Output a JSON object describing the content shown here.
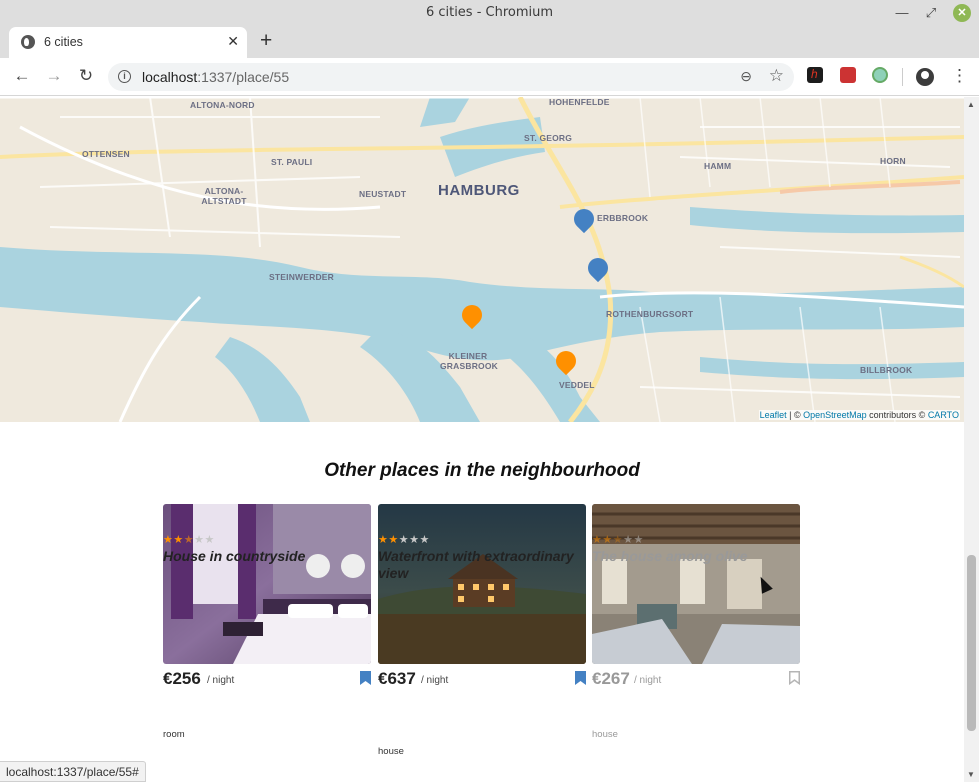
{
  "window": {
    "title": "6 cities - Chromium"
  },
  "tab": {
    "title": "6 cities"
  },
  "address_bar": {
    "host": "localhost",
    "path": ":1337/place/55"
  },
  "map": {
    "city_label": "HAMBURG",
    "districts": [
      "ALTONA-NORD",
      "HOHENFELDE",
      "OTTENSEN",
      "ST. PAULI",
      "ST. GEORG",
      "HAMM",
      "HORN",
      "ALTONA-ALTSTADT",
      "NEUSTADT",
      "ERBBROOK",
      "STEINWERDER",
      "ROTHENBURGSORT",
      "KLEINER GRASBROOK",
      "VEDDEL",
      "BILLBROOK"
    ],
    "attribution": {
      "leaflet": "Leaflet",
      "sep": " | © ",
      "osm": "OpenStreetMap",
      "mid": " contributors © ",
      "carto": "CARTO"
    }
  },
  "neighbourhood": {
    "title": "Other places in the neighbourhood",
    "per_night": "/ night",
    "cards": [
      {
        "price": "€256",
        "rating": 2.5,
        "name": "House in countryside",
        "type": "room",
        "bookmarked": true
      },
      {
        "price": "€637",
        "rating": 2,
        "name": "Waterfront with extraordinary view",
        "type": "house",
        "bookmarked": true
      },
      {
        "price": "€267",
        "rating": 2.5,
        "name": "The house among olive",
        "type": "house",
        "bookmarked": false
      }
    ]
  },
  "status_bar": {
    "url": "localhost:1337/place/55#"
  },
  "colors": {
    "accent_orange": "#ff9000",
    "bookmark_blue": "#4481c3",
    "map_marker_blue": "#4481c3"
  }
}
